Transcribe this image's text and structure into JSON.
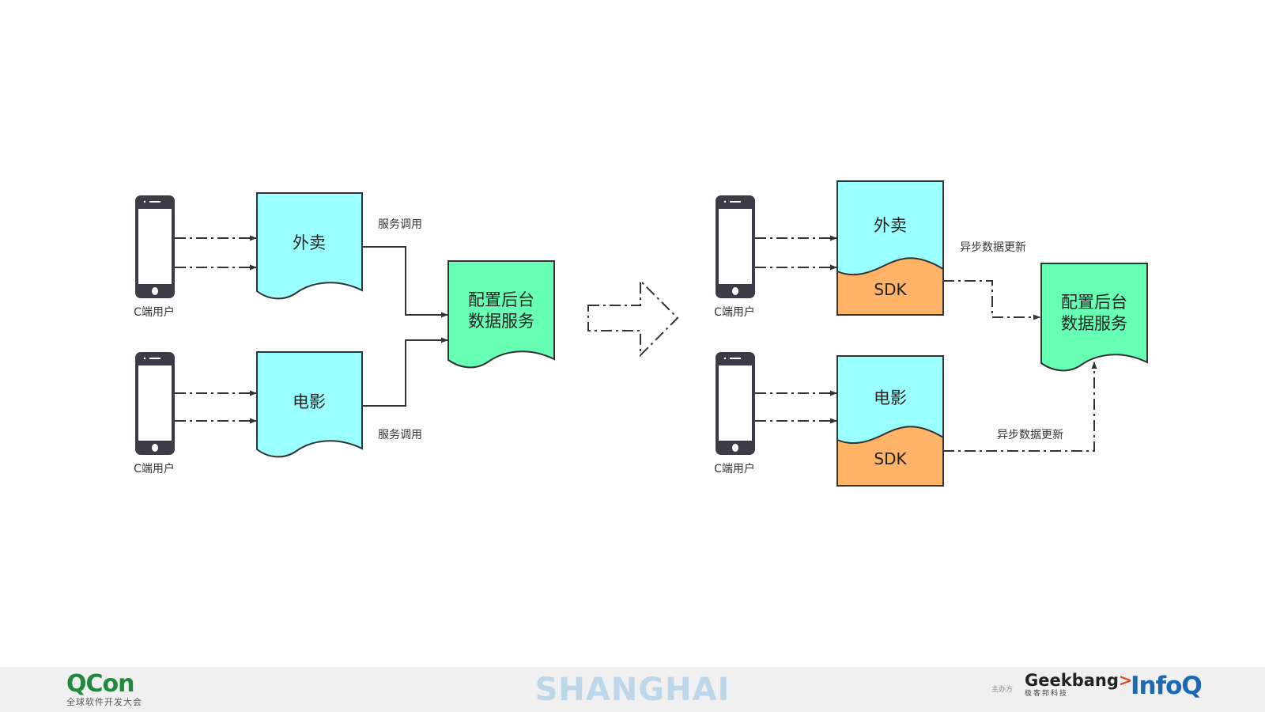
{
  "diagram": {
    "before": {
      "client_label_1": "C端用户",
      "client_label_2": "C端用户",
      "box_waimai": "外卖",
      "box_movie": "电影",
      "call_label_top": "服务调用",
      "call_label_bottom": "服务调用",
      "backend_line1": "配置后台",
      "backend_line2": "数据服务"
    },
    "after": {
      "client_label_1": "C端用户",
      "client_label_2": "C端用户",
      "box_waimai": "外卖",
      "box_movie": "电影",
      "sdk_top": "SDK",
      "sdk_bottom": "SDK",
      "async_label_top": "异步数据更新",
      "async_label_bottom": "异步数据更新",
      "backend_line1": "配置后台",
      "backend_line2": "数据服务"
    },
    "colors": {
      "cyan": "#99ffff",
      "green": "#66ffb3",
      "orange": "#ffb366",
      "stroke": "#333333",
      "phone": "#3a3d47"
    }
  },
  "footer": {
    "qcon_title": "QCon",
    "qcon_subtitle": "全球软件开发大会",
    "city": "SHANGHAI",
    "sponsor_label": "主办方",
    "geekbang_word": "Geekbang",
    "geekbang_arrow": ">.",
    "geekbang_subtitle": "极客邦科技",
    "infoq": "InfoQ"
  }
}
